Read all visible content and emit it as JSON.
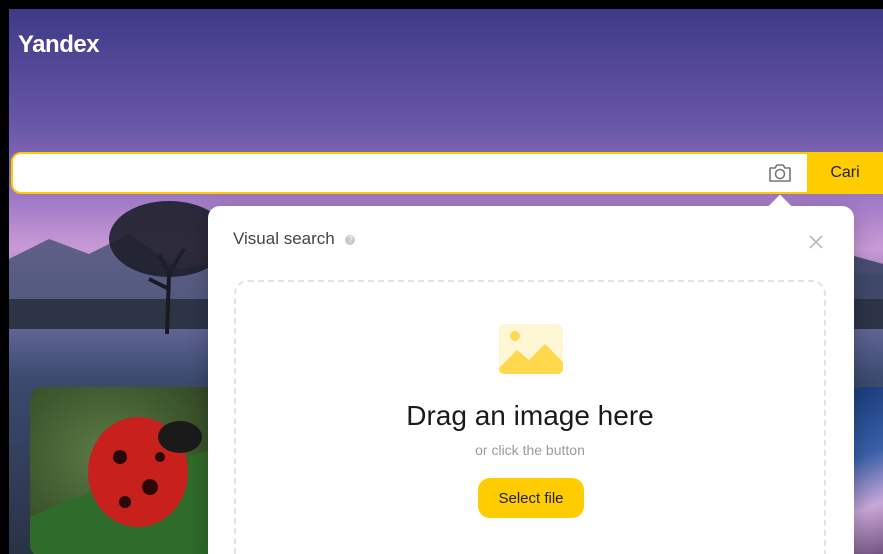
{
  "header": {
    "logo": "Yandex"
  },
  "search": {
    "value": "",
    "placeholder": "",
    "button_label": "Cari",
    "camera_icon": "camera-icon"
  },
  "visual_search": {
    "title": "Visual search",
    "help_icon": "help-icon",
    "close_icon": "close-icon",
    "image_icon": "image-placeholder-icon",
    "drag_text": "Drag an image here",
    "or_text": "or click the button",
    "select_button_label": "Select file"
  },
  "colors": {
    "accent": "#ffcc00",
    "dialog_bg": "#ffffff",
    "dropzone_border": "#e3e3e3"
  }
}
